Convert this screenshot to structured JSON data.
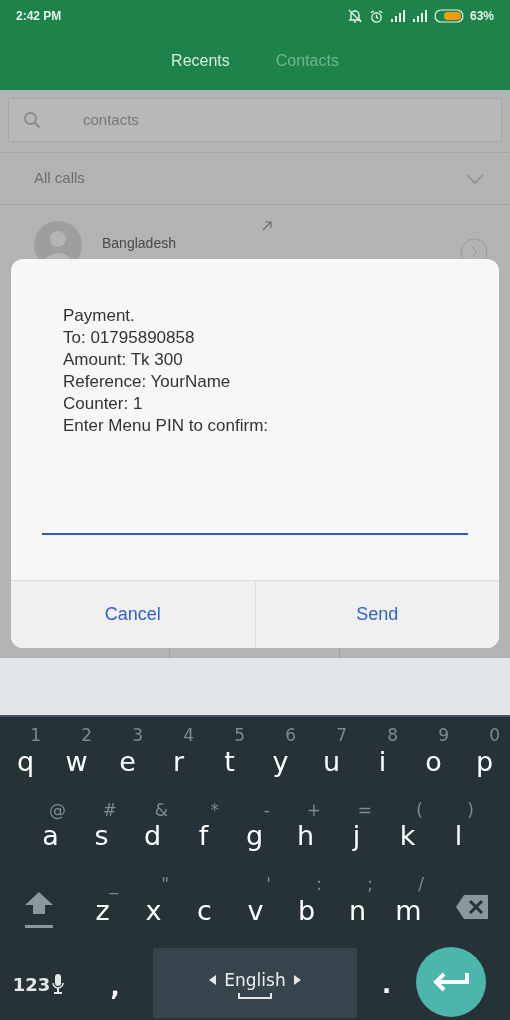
{
  "status_bar": {
    "time": "2:42 PM",
    "battery": "63%"
  },
  "tabs": [
    {
      "label": "Recents",
      "selected": true
    },
    {
      "label": "Contacts",
      "selected": false
    }
  ],
  "search": {
    "placeholder": "contacts"
  },
  "filter": {
    "label": "All calls"
  },
  "calls": [
    {
      "subtitle": "Bangladesh"
    }
  ],
  "dialog": {
    "message": [
      "Payment.",
      "To: 01795890858",
      "Amount: Tk 300",
      "Reference: YourName",
      "Counter: 1",
      "Enter Menu PIN to confirm:"
    ],
    "buttons": [
      "Cancel",
      "Send"
    ]
  },
  "keyboard": {
    "rows": [
      [
        {
          "label": "q",
          "hint": "1"
        },
        {
          "label": "w",
          "hint": "2"
        },
        {
          "label": "e",
          "hint": "3"
        },
        {
          "label": "r",
          "hint": "4"
        },
        {
          "label": "t",
          "hint": "5"
        },
        {
          "label": "y",
          "hint": "6"
        },
        {
          "label": "u",
          "hint": "7"
        },
        {
          "label": "i",
          "hint": "8"
        },
        {
          "label": "o",
          "hint": "9"
        },
        {
          "label": "p",
          "hint": "0"
        }
      ],
      [
        {
          "label": "a",
          "hint": "@"
        },
        {
          "label": "s",
          "hint": "#"
        },
        {
          "label": "d",
          "hint": "&"
        },
        {
          "label": "f",
          "hint": "*"
        },
        {
          "label": "g",
          "hint": "-"
        },
        {
          "label": "h",
          "hint": "+"
        },
        {
          "label": "j",
          "hint": "="
        },
        {
          "label": "k",
          "hint": "("
        },
        {
          "label": "l",
          "hint": ")"
        }
      ],
      [
        {
          "label": "z",
          "hint": "_"
        },
        {
          "label": "x",
          "hint": "\""
        },
        {
          "label": "c"
        },
        {
          "label": "v",
          "hint": "'"
        },
        {
          "label": "b",
          "hint": ":"
        },
        {
          "label": "n",
          "hint": ";"
        },
        {
          "label": "m",
          "hint": "/"
        }
      ]
    ],
    "symbols_key": "123",
    "comma": ",",
    "period": ".",
    "language": "English"
  }
}
